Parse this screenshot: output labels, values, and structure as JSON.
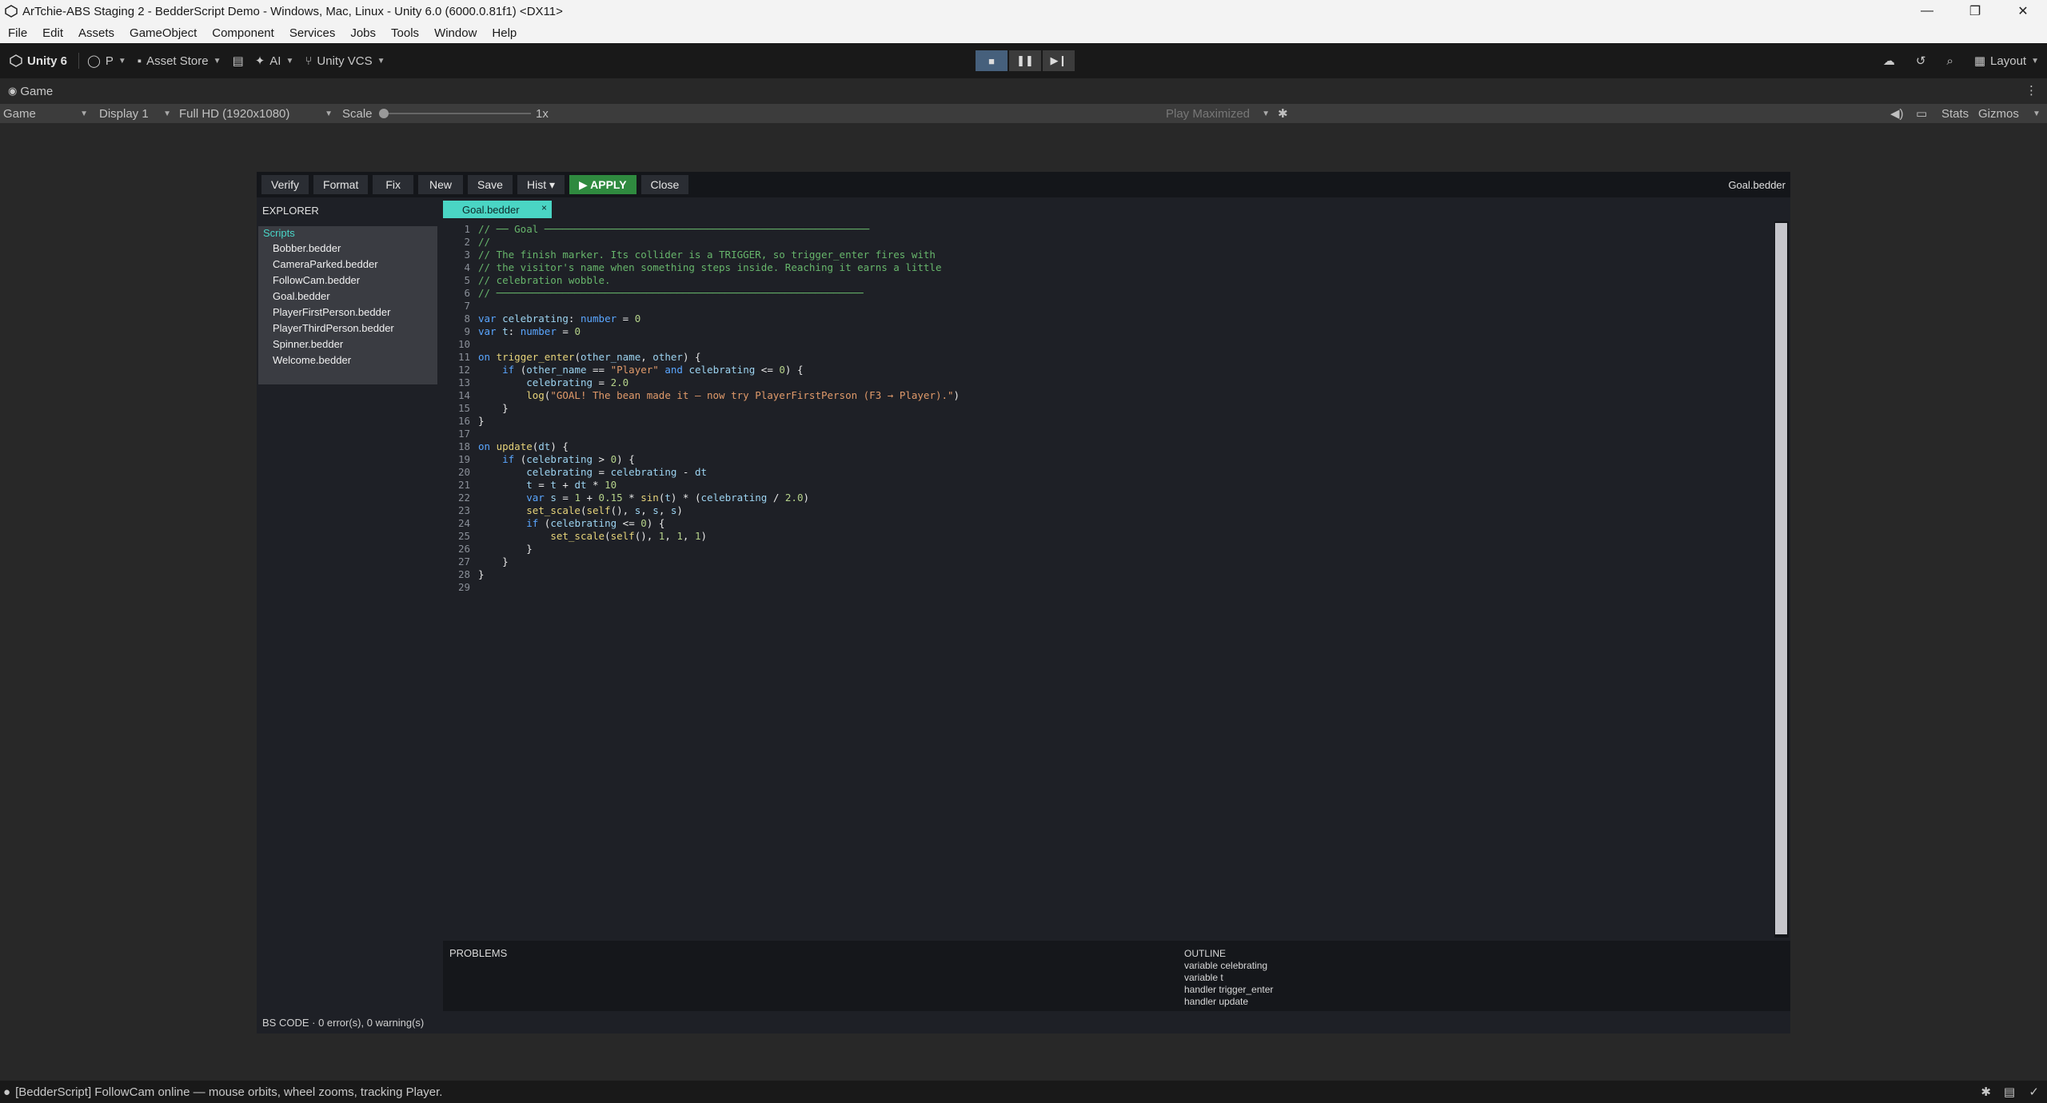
{
  "window": {
    "title": "ArTchie-ABS Staging 2 - BedderScript Demo - Windows, Mac, Linux - Unity 6.0 (6000.0.81f1) <DX11>",
    "controls": [
      "—",
      "❐",
      "✕"
    ]
  },
  "menubar": [
    "File",
    "Edit",
    "Assets",
    "GameObject",
    "Component",
    "Services",
    "Jobs",
    "Tools",
    "Window",
    "Help"
  ],
  "toolbar": {
    "unity": "Unity 6",
    "account": "P",
    "asset_store": "Asset Store",
    "ai": "AI",
    "vcs": "Unity VCS",
    "layout": "Layout"
  },
  "game_tab": {
    "label": "Game",
    "view_select": "Game",
    "display": "Display 1",
    "resolution": "Full HD (1920x1080)",
    "scale_label": "Scale",
    "scale_value": "1x",
    "play_mode": "Play Maximized",
    "stats": "Stats",
    "gizmos": "Gizmos"
  },
  "editor": {
    "buttons": {
      "verify": "Verify",
      "format": "Format",
      "fix": "Fix",
      "new": "New",
      "save": "Save",
      "hist": "Hist ▾",
      "apply": "▶ APPLY",
      "close": "Close"
    },
    "current_file": "Goal.bedder",
    "explorer_title": "EXPLORER",
    "scripts_label": "Scripts",
    "files": [
      "Bobber.bedder",
      "CameraParked.bedder",
      "FollowCam.bedder",
      "Goal.bedder",
      "PlayerFirstPerson.bedder",
      "PlayerThirdPerson.bedder",
      "Spinner.bedder",
      "Welcome.bedder"
    ],
    "active_tab": "Goal.bedder",
    "tab_close": "×",
    "code_lines": [
      "// ── Goal ──────────────────────────────────────────────────────",
      "//",
      "// The finish marker. Its collider is a TRIGGER, so trigger_enter fires with",
      "// the visitor's name when something steps inside. Reaching it earns a little",
      "// celebration wobble.",
      "// ─────────────────────────────────────────────────────────────",
      "",
      "var celebrating: number = 0",
      "var t: number = 0",
      "",
      "on trigger_enter(other_name, other) {",
      "    if (other_name == \"Player\" and celebrating <= 0) {",
      "        celebrating = 2.0",
      "        log(\"GOAL! The bean made it — now try PlayerFirstPerson (F3 → Player).\")",
      "    }",
      "}",
      "",
      "on update(dt) {",
      "    if (celebrating > 0) {",
      "        celebrating = celebrating - dt",
      "        t = t + dt * 10",
      "        var s = 1 + 0.15 * sin(t) * (celebrating / 2.0)",
      "        set_scale(self(), s, s, s)",
      "        if (celebrating <= 0) {",
      "            set_scale(self(), 1, 1, 1)",
      "        }",
      "    }",
      "}",
      ""
    ],
    "problems_title": "PROBLEMS",
    "outline_title": "OUTLINE",
    "outline_items": [
      "variable celebrating",
      "variable t",
      "handler trigger_enter",
      "handler update"
    ],
    "status": "BS CODE · 0 error(s), 0 warning(s)"
  },
  "status_bar": {
    "message": "[BedderScript] FollowCam online — mouse orbits, wheel zooms, tracking Player."
  },
  "colors": {
    "accent_teal": "#4ad5c4",
    "apply_green": "#2f8a3f",
    "comment": "#67b56b",
    "keyword": "#5aa6ff",
    "string": "#e09a6a"
  }
}
